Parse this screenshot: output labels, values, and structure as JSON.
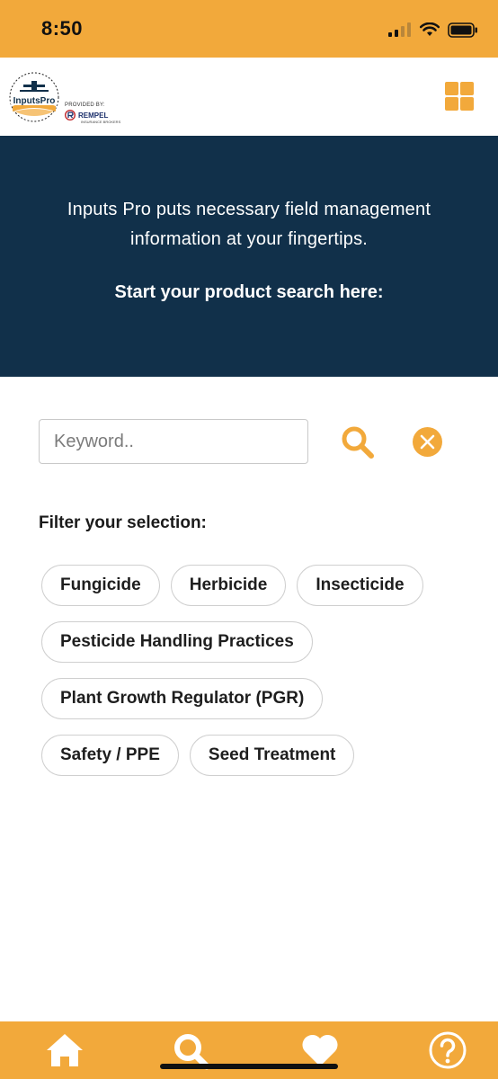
{
  "status_bar": {
    "time": "8:50"
  },
  "header": {
    "logo_text": "InputsPro",
    "provided_by": "PROVIDED BY:",
    "provider": "REMPEL",
    "provider_sub": "INSURANCE BROKERS"
  },
  "hero": {
    "description": "Inputs Pro puts necessary field management information at your fingertips.",
    "cta": "Start your product search here:"
  },
  "search": {
    "placeholder": "Keyword..",
    "value": ""
  },
  "filter": {
    "title": "Filter your selection:",
    "rows": [
      [
        "Fungicide",
        "Herbicide",
        "Insecticide"
      ],
      [
        "Pesticide Handling Practices"
      ],
      [
        "Plant Growth Regulator (PGR)"
      ],
      [
        "Safety / PPE",
        "Seed Treatment"
      ]
    ]
  },
  "tabs": [
    "home-icon",
    "search-icon",
    "heart-icon",
    "help-icon"
  ],
  "colors": {
    "accent": "#F2A93B",
    "hero_bg": "#11304A",
    "text": "#1e1e1e"
  }
}
